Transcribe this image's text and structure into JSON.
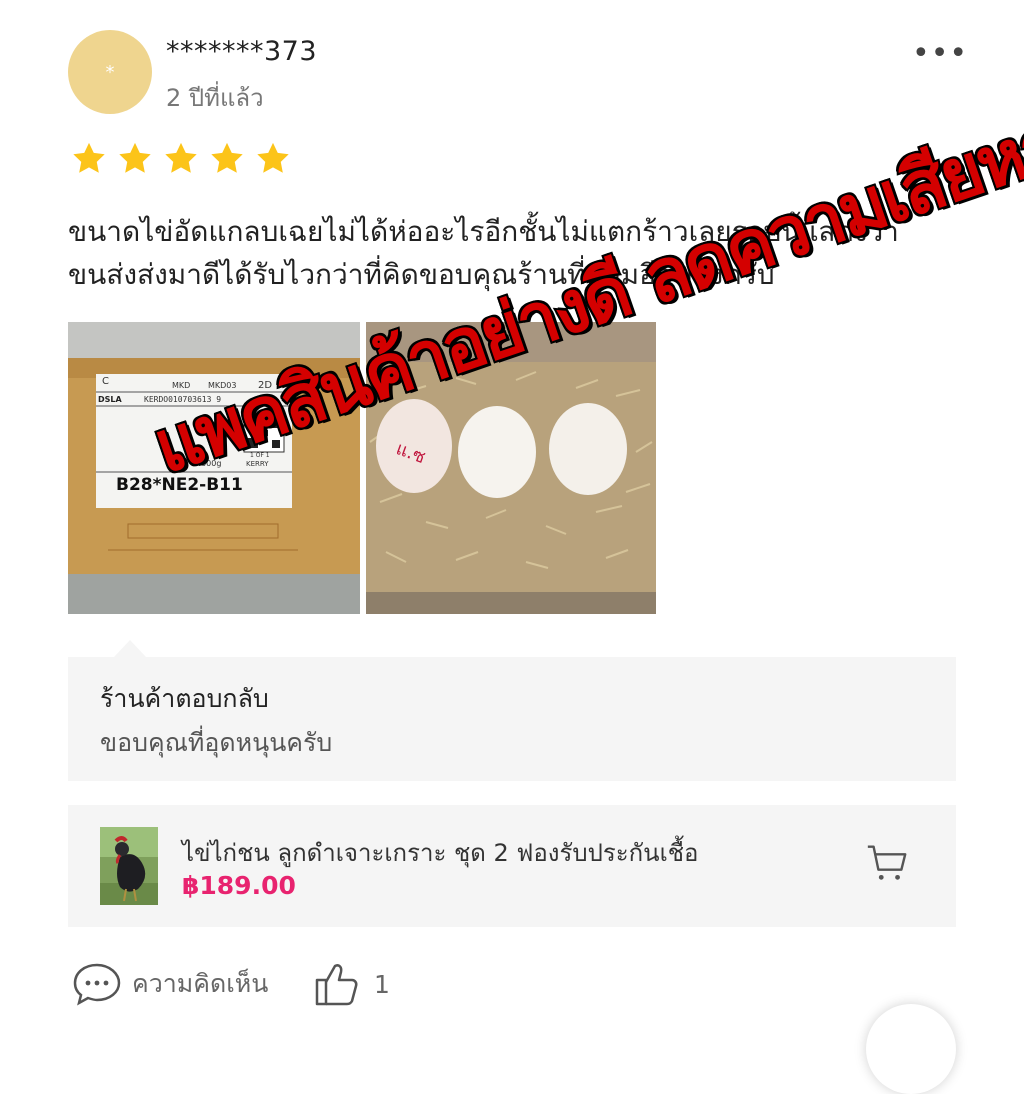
{
  "review": {
    "avatar_initial": "*",
    "username": "*******373",
    "time_ago": "2 ปีที่แล้ว",
    "more_icon": "more-icon",
    "rating": 5,
    "rating_max": 5,
    "text_line1": "ขนาดไข่อัดแกลบเฉยไม่ได้ห่ออะไรอีกชั้นไม่แตกร้าวเลยรอบนี้แสดงว่า",
    "text_line2": "ขนส่งส่งมาดีได้รับไวกว่าที่คิดขอบคุณร้านที่แถมอีกฟองครับ"
  },
  "photo1": {
    "label_top_left": "C",
    "label_mkd": "MKD",
    "label_mkd2": "MKD03",
    "label_2d": "2D",
    "label_brand": "DSLA",
    "tracking": "KERDO010703613 9",
    "weight": "4000g",
    "route_code": "B28*NE2-B11",
    "page": "1 OF 1",
    "carrier": "KERRY"
  },
  "photo2": {
    "egg_marking": "แ.ซ"
  },
  "overlay": {
    "text": "แพคสินค้าอย่างดี ลดความเสียหายจากการขนส่ง",
    "color": "#d40000"
  },
  "seller_reply": {
    "label": "ร้านค้าตอบกลับ",
    "text": "ขอบคุณที่อุดหนุนครับ"
  },
  "product": {
    "name": "ไข่ไก่ชน ลูกดำเจาะเกราะ ชุด 2 ฟองรับประกันเชื้อ",
    "price": "฿189.00",
    "price_color": "#e8236f",
    "cart_icon": "cart-icon"
  },
  "footer": {
    "comment_label": "ความคิดเห็น",
    "like_count": "1"
  }
}
